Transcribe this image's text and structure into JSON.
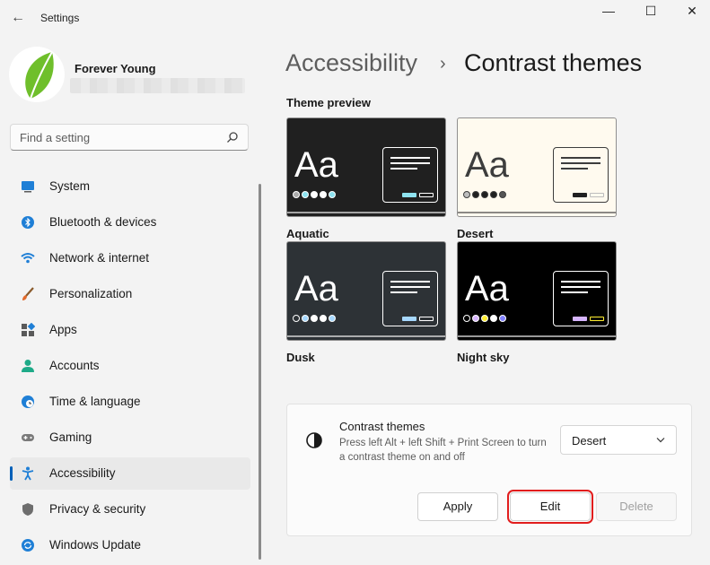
{
  "window": {
    "title": "Settings",
    "controls": {
      "minimize": "—",
      "maximize": "☐",
      "close": "✕"
    }
  },
  "user": {
    "name": "Forever Young"
  },
  "search": {
    "placeholder": "Find a setting"
  },
  "nav": {
    "items": [
      {
        "label": "System",
        "icon": "monitor-icon"
      },
      {
        "label": "Bluetooth & devices",
        "icon": "bluetooth-icon"
      },
      {
        "label": "Network & internet",
        "icon": "wifi-icon"
      },
      {
        "label": "Personalization",
        "icon": "brush-icon"
      },
      {
        "label": "Apps",
        "icon": "apps-icon"
      },
      {
        "label": "Accounts",
        "icon": "person-icon"
      },
      {
        "label": "Time & language",
        "icon": "globe-clock-icon"
      },
      {
        "label": "Gaming",
        "icon": "gamepad-icon"
      },
      {
        "label": "Accessibility",
        "icon": "accessibility-icon",
        "selected": true
      },
      {
        "label": "Privacy & security",
        "icon": "shield-icon"
      },
      {
        "label": "Windows Update",
        "icon": "update-icon"
      }
    ]
  },
  "breadcrumb": {
    "parent": "Accessibility",
    "separator": "›",
    "current": "Contrast themes"
  },
  "preview": {
    "label": "Theme preview",
    "aa_text": "Aa",
    "themes": [
      {
        "name": "Aquatic",
        "bg": "#202020",
        "fg": "#ffffff",
        "accent": "#8ee3f0",
        "btn2": "#ffffff",
        "dots": [
          "#aaaaaa",
          "#8ee3f0",
          "#ffffff",
          "#ffffff",
          "#8ee3f0"
        ]
      },
      {
        "name": "Desert",
        "bg": "#fffaef",
        "fg": "#3d3d3d",
        "accent": "#202020",
        "btn2": "#bdbdbd",
        "dots": [
          "#bdbdbd",
          "#202020",
          "#202020",
          "#202020",
          "#555555"
        ]
      },
      {
        "name": "Dusk",
        "bg": "#2d3236",
        "fg": "#ffffff",
        "accent": "#a6d8ff",
        "btn2": "#ffffff",
        "dots": [
          "#2d3236",
          "#a6d8ff",
          "#ffffff",
          "#ffffff",
          "#a6d8ff"
        ]
      },
      {
        "name": "Night sky",
        "bg": "#000000",
        "fg": "#ffffff",
        "accent": "#d6b4fd",
        "btn2": "#ffee32",
        "dots": [
          "#000000",
          "#d6b4fd",
          "#ffee32",
          "#ffffff",
          "#8080ff"
        ]
      }
    ]
  },
  "settings_card": {
    "title": "Contrast themes",
    "description": "Press left Alt + left Shift + Print Screen to turn a contrast theme on and off",
    "dropdown_value": "Desert",
    "buttons": {
      "apply": "Apply",
      "edit": "Edit",
      "delete": "Delete"
    }
  },
  "colors": {
    "accent": "#005fb8",
    "highlight_box": "#e11d1d"
  }
}
